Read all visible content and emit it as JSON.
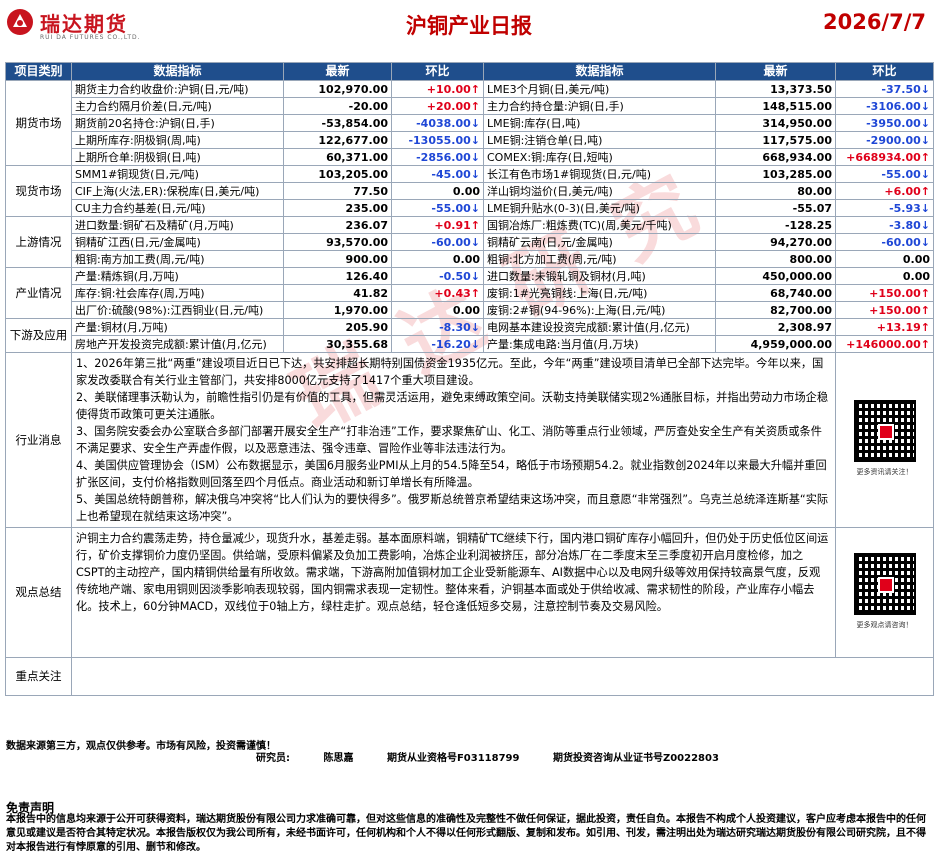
{
  "header": {
    "logo_text": "瑞达期货",
    "logo_sub": "RUI DA FUTURES CO.,LTD.",
    "title": "沪铜产业日报",
    "date": "2026/7/7"
  },
  "table_headers": [
    "项目类别",
    "数据指标",
    "最新",
    "环比",
    "数据指标",
    "最新",
    "环比"
  ],
  "sections": [
    {
      "category": "期货市场",
      "rows": [
        {
          "l_label": "期货主力合约收盘价:沪铜(日,元/吨)",
          "l_val": "102,970.00",
          "l_chg": "+10.00↑",
          "l_dir": "up",
          "r_label": "LME3个月铜(日,美元/吨)",
          "r_val": "13,373.50",
          "r_chg": "-37.50↓",
          "r_dir": "down"
        },
        {
          "l_label": "主力合约隔月价差(日,元/吨)",
          "l_val": "-20.00",
          "l_chg": "+20.00↑",
          "l_dir": "up",
          "r_label": "主力合约持仓量:沪铜(日,手)",
          "r_val": "148,515.00",
          "r_chg": "-3106.00↓",
          "r_dir": "down"
        },
        {
          "l_label": "期货前20名持仓:沪铜(日,手)",
          "l_val": "-53,854.00",
          "l_chg": "-4038.00↓",
          "l_dir": "down",
          "r_label": "LME铜:库存(日,吨)",
          "r_val": "314,950.00",
          "r_chg": "-3950.00↓",
          "r_dir": "down"
        },
        {
          "l_label": "上期所库存:阴极铜(周,吨)",
          "l_val": "122,677.00",
          "l_chg": "-13055.00↓",
          "l_dir": "down",
          "r_label": "LME铜:注销仓单(日,吨)",
          "r_val": "117,575.00",
          "r_chg": "-2900.00↓",
          "r_dir": "down"
        },
        {
          "l_label": "上期所仓单:阴极铜(日,吨)",
          "l_val": "60,371.00",
          "l_chg": "-2856.00↓",
          "l_dir": "down",
          "r_label": "COMEX:铜:库存(日,短吨)",
          "r_val": "668,934.00",
          "r_chg": "+668934.00↑",
          "r_dir": "up"
        }
      ]
    },
    {
      "category": "现货市场",
      "rows": [
        {
          "l_label": "SMM1#铜现货(日,元/吨)",
          "l_val": "103,205.00",
          "l_chg": "-45.00↓",
          "l_dir": "down",
          "r_label": "长江有色市场1#铜现货(日,元/吨)",
          "r_val": "103,285.00",
          "r_chg": "-55.00↓",
          "r_dir": "down"
        },
        {
          "l_label": "CIF上海(火法,ER):保税库(日,美元/吨)",
          "l_val": "77.50",
          "l_chg": "0.00",
          "l_dir": "flat",
          "r_label": "洋山铜均溢价(日,美元/吨)",
          "r_val": "80.00",
          "r_chg": "+6.00↑",
          "r_dir": "up"
        },
        {
          "l_label": "CU主力合约基差(日,元/吨)",
          "l_val": "235.00",
          "l_chg": "-55.00↓",
          "l_dir": "down",
          "r_label": "LME铜升贴水(0-3)(日,美元/吨)",
          "r_val": "-55.07",
          "r_chg": "-5.93↓",
          "r_dir": "down"
        }
      ]
    },
    {
      "category": "上游情况",
      "rows": [
        {
          "l_label": "进口数量:铜矿石及精矿(月,万吨)",
          "l_val": "236.07",
          "l_chg": "+0.91↑",
          "l_dir": "up",
          "r_label": "国铜冶炼厂:粗炼费(TC)(周,美元/千吨)",
          "r_val": "-128.25",
          "r_chg": "-3.80↓",
          "r_dir": "down"
        },
        {
          "l_label": "铜精矿江西(日,元/金属吨)",
          "l_val": "93,570.00",
          "l_chg": "-60.00↓",
          "l_dir": "down",
          "r_label": "铜精矿云南(日,元/金属吨)",
          "r_val": "94,270.00",
          "r_chg": "-60.00↓",
          "r_dir": "down"
        },
        {
          "l_label": "粗铜:南方加工费(周,元/吨)",
          "l_val": "900.00",
          "l_chg": "0.00",
          "l_dir": "flat",
          "r_label": "粗铜:北方加工费(周,元/吨)",
          "r_val": "800.00",
          "r_chg": "0.00",
          "r_dir": "flat"
        }
      ]
    },
    {
      "category": "产业情况",
      "rows": [
        {
          "l_label": "产量:精炼铜(月,万吨)",
          "l_val": "126.40",
          "l_chg": "-0.50↓",
          "l_dir": "down",
          "r_label": "进口数量:未锻轧铜及铜材(月,吨)",
          "r_val": "450,000.00",
          "r_chg": "0.00",
          "r_dir": "flat"
        },
        {
          "l_label": "库存:铜:社会库存(周,万吨)",
          "l_val": "41.82",
          "l_chg": "+0.43↑",
          "l_dir": "up",
          "r_label": "废铜:1#光亮铜线:上海(日,元/吨)",
          "r_val": "68,740.00",
          "r_chg": "+150.00↑",
          "r_dir": "up"
        },
        {
          "l_label": "出厂价:硫酸(98%):江西铜业(日,元/吨)",
          "l_val": "1,970.00",
          "l_chg": "0.00",
          "l_dir": "flat",
          "r_label": "废铜:2#铜(94-96%):上海(日,元/吨)",
          "r_val": "82,700.00",
          "r_chg": "+150.00↑",
          "r_dir": "up"
        }
      ]
    },
    {
      "category": "下游及应用",
      "rows": [
        {
          "l_label": "产量:铜材(月,万吨)",
          "l_val": "205.90",
          "l_chg": "-8.30↓",
          "l_dir": "down",
          "r_label": "电网基本建设投资完成额:累计值(月,亿元)",
          "r_val": "2,308.97",
          "r_chg": "+13.19↑",
          "r_dir": "up"
        },
        {
          "l_label": "房地产开发投资完成额:累计值(月,亿元)",
          "l_val": "30,355.68",
          "l_chg": "-16.20↓",
          "l_dir": "down",
          "r_label": "产量:集成电路:当月值(月,万块)",
          "r_val": "4,959,000.00",
          "r_chg": "+146000.00↑",
          "r_dir": "up"
        }
      ]
    }
  ],
  "news": {
    "category": "行业消息",
    "paragraphs": [
      "1、2026年第三批“两重”建设项目近日已下达，共安排超长期特别国债资金1935亿元。至此，今年“两重”建设项目清单已全部下达完毕。今年以来，国家发改委联合有关行业主管部门，共安排8000亿元支持了1417个重大项目建设。",
      "2、美联储理事沃勒认为，前瞻性指引仍是有价值的工具，但需灵活运用，避免束缚政策空间。沃勒支持美联储实现2%通胀目标，并指出劳动力市场企稳使得货币政策可更关注通胀。",
      "3、国务院安委会办公室联合多部门部署开展安全生产“打非治违”工作，要求聚焦矿山、化工、消防等重点行业领域，严厉查处安全生产有关资质或条件不满足要求、安全生产弄虚作假，以及恶意违法、强令违章、冒险作业等非法违法行为。",
      "4、美国供应管理协会（ISM）公布数据显示，美国6月服务业PMI从上月的54.5降至54，略低于市场预期54.2。就业指数创2024年以来最大升幅并重回扩张区间，支付价格指数则回落至四个月低点。商业活动和新订单增长有所降温。",
      "5、美国总统特朗普称，解决俄乌冲突将“比人们认为的要快得多”。俄罗斯总统普京希望结束这场冲突，而且意愿“非常强烈”。乌克兰总统泽连斯基“实际上也希望现在就结束这场冲突”。"
    ],
    "qr_caption": "更多资讯请关注！"
  },
  "view": {
    "category": "观点总结",
    "text": "沪铜主力合约震荡走势，持仓量减少，现货升水，基差走弱。基本面原料端，铜精矿TC继续下行，国内港口铜矿库存小幅回升，但仍处于历史低位区间运行，矿价支撑铜价力度仍坚固。供给端，受原料偏紧及负加工费影响，冶炼企业利润被挤压，部分冶炼厂在二季度末至三季度初开启月度检修，加之CSPT的主动控产，国内精铜供给量有所收敛。需求端，下游高附加值铜材加工企业受新能源车、AI数据中心以及电网升级等效用保持较高景气度，反观传统地产端、家电用铜则因淡季影响表现较弱，国内铜需求表现一定韧性。整体来看，沪铜基本面或处于供给收减、需求韧性的阶段，产业库存小幅去化。技术上，60分钟MACD，双线位于0轴上方，绿柱走扩。观点总结，轻仓逢低短多交易，注意控制节奏及交易风险。",
    "qr_caption": "更多观点请咨询！"
  },
  "focus": {
    "category": "重点关注",
    "text": ""
  },
  "watermark": "瑞达研究",
  "footer": {
    "source": "数据来源第三方，观点仅供参考。市场有风险，投资需谨慎！",
    "researcher_label": "研究员:",
    "researcher_name": "陈思嘉",
    "license1": "期货从业资格号F03118799",
    "license2": "期货投资咨询从业证书号Z0022803"
  },
  "disclaimer": {
    "title": "免责声明",
    "body": "本报告中的信息均来源于公开可获得资料，瑞达期货股份有限公司力求准确可靠，但对这些信息的准确性及完整性不做任何保证，据此投资，责任自负。本报告不构成个人投资建议，客户应考虑本报告中的任何意见或建议是否符合其特定状况。本报告版权仅为我公司所有，未经书面许可，任何机构和个人不得以任何形式翻版、复制和发布。如引用、刊发，需注明出处为瑞达研究瑞达期货股份有限公司研究院，且不得对本报告进行有悖原意的引用、删节和修改。"
  },
  "colors": {
    "header_bg": "#1f4e8c",
    "up": "#e0001a",
    "down": "#1f47d6",
    "title": "#c00000"
  }
}
